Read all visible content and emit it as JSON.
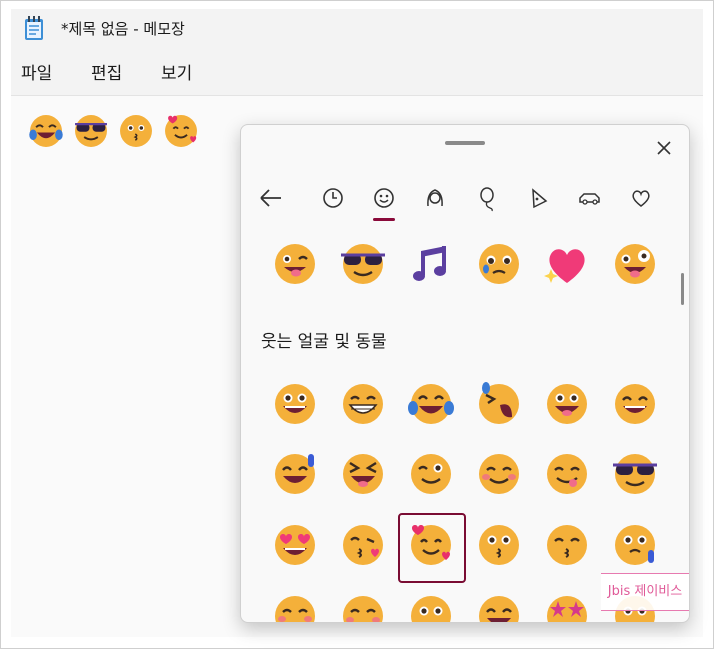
{
  "window": {
    "title": "*제목 없음 - 메모장",
    "app_icon": "notepad-icon"
  },
  "menu": {
    "items": [
      "파일",
      "편집",
      "보기"
    ]
  },
  "document": {
    "typed_emojis": [
      "face-with-tears-of-joy",
      "smiling-face-with-sunglasses",
      "kissing-face",
      "smiling-face-with-hearts"
    ]
  },
  "emoji_panel": {
    "tabs": [
      {
        "icon": "back-arrow-icon"
      },
      {
        "icon": "clock-icon"
      },
      {
        "icon": "smiley-icon",
        "selected": true
      },
      {
        "icon": "person-icon"
      },
      {
        "icon": "balloon-icon"
      },
      {
        "icon": "pizza-icon"
      },
      {
        "icon": "car-icon"
      },
      {
        "icon": "heart-icon"
      }
    ],
    "section_title": "웃는 얼굴 및 동물",
    "accent_color": "#8a0a3a",
    "recent_row": [
      "winking-face-with-tongue",
      "smiling-face-with-sunglasses",
      "musical-notes",
      "face-holding-back-tears",
      "sparkling-heart",
      "zany-face"
    ],
    "grid": [
      [
        "grinning-face",
        "grinning-face-with-big-eyes",
        "face-with-tears-of-joy",
        "rolling-on-the-floor-laughing",
        "grinning-face-with-smiling-eyes",
        "beaming-face"
      ],
      [
        "grinning-face-with-sweat",
        "grinning-squinting-face",
        "winking-face",
        "smiling-face-with-blush",
        "face-savoring-food",
        "smiling-face-with-sunglasses"
      ],
      [
        "smiling-face-with-heart-eyes",
        "face-blowing-a-kiss",
        "smiling-face-with-hearts",
        "kissing-face",
        "kissing-face-with-smiling-eyes",
        "face-with-open-mouth-sweat"
      ],
      [
        "smiling-face-with-blush",
        "kissing-face-blush",
        "face-open-eyes",
        "beaming-face",
        "star-struck",
        "face-open-eyes"
      ]
    ],
    "selected_emoji": "smiling-face-with-hearts"
  },
  "watermark": "Jbis 제이비스"
}
